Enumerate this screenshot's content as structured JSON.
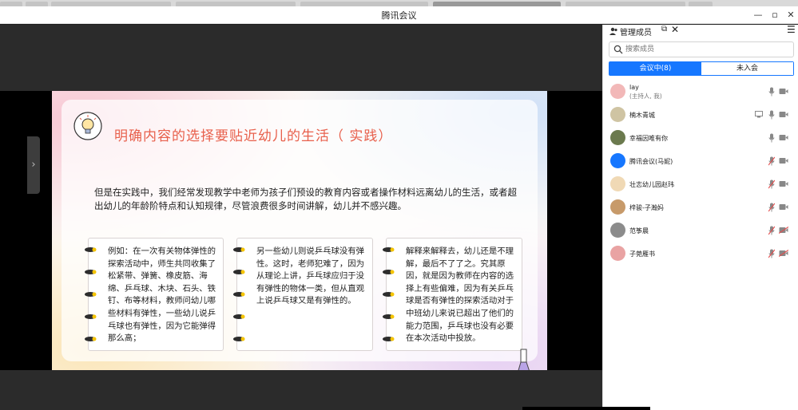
{
  "window": {
    "title": "腾讯会议"
  },
  "slide": {
    "title": "明确内容的选择要贴近幼儿的生活（ 实践）",
    "intro": "但是在实践中，我们经常发现教学中老师为孩子们预设的教育内容或者操作材料远离幼儿的生活，或者超出幼儿的年龄阶特点和认知规律，尽管浪费很多时间讲解，幼儿并不感兴趣。",
    "cards": [
      {
        "text": "例如：在一次有关物体弹性的探索活动中，师生共同收集了松紧带、弹簧、橡皮筋、海绵、乒乓球、木块、石头、铁钉、布等材料，教师问幼儿哪些材料有弹性，一些幼儿说乒乓球也有弹性，因为它能弹得那么高；"
      },
      {
        "text": "另一些幼儿则说乒乓球没有弹性。这时，老师犯难了，因为从理论上讲，乒乓球应归于没有弹性的物体一类，但从直观上说乒乓球又是有弹性的。"
      },
      {
        "text": "解释来解释去，幼儿还是不理解，最后不了了之。究其原因，就是因为教师在内容的选择上有些偏难，因为有关乒乓球是否有弹性的探索活动对于中班幼儿来说已超出了他们的能力范围，乒乓球也没有必要在本次活动中投放。"
      }
    ]
  },
  "panel": {
    "title": "管理成员",
    "search_placeholder": "搜索成员",
    "tab_active": "会议中(8)",
    "tab_other": "未入会",
    "members": [
      {
        "name": "lay",
        "sub": "(主持人, 我)",
        "avatar_color": "#f2b8b8",
        "mic": "on",
        "cam": "on",
        "share": false
      },
      {
        "name": "楠木青城",
        "avatar_color": "#cfc4a3",
        "mic": "on",
        "cam": "on",
        "share": true
      },
      {
        "name": "幸福因唯有你",
        "avatar_color": "#6b7a4e",
        "mic": "on",
        "cam": "on",
        "share": false
      },
      {
        "name": "腾讯会议(马妮)",
        "avatar_color": "#1677ff",
        "mic": "muted",
        "cam": "on",
        "share": false
      },
      {
        "name": "壮志幼儿园赵玮",
        "avatar_color": "#f0d9b5",
        "mic": "muted",
        "cam": "on",
        "share": false
      },
      {
        "name": "梓骏-子瀚妈",
        "avatar_color": "#c79a6a",
        "mic": "muted",
        "cam": "on",
        "share": false
      },
      {
        "name": "范筝晨",
        "avatar_color": "#8c8c8c",
        "mic": "muted",
        "cam": "off",
        "share": false
      },
      {
        "name": "子菀雁书",
        "avatar_color": "#e9a3a3",
        "mic": "muted",
        "cam": "off",
        "share": false
      }
    ]
  },
  "colors": {
    "accent": "#1677ff",
    "slide_title": "#e8604c",
    "muted_red": "#e34d4d"
  }
}
